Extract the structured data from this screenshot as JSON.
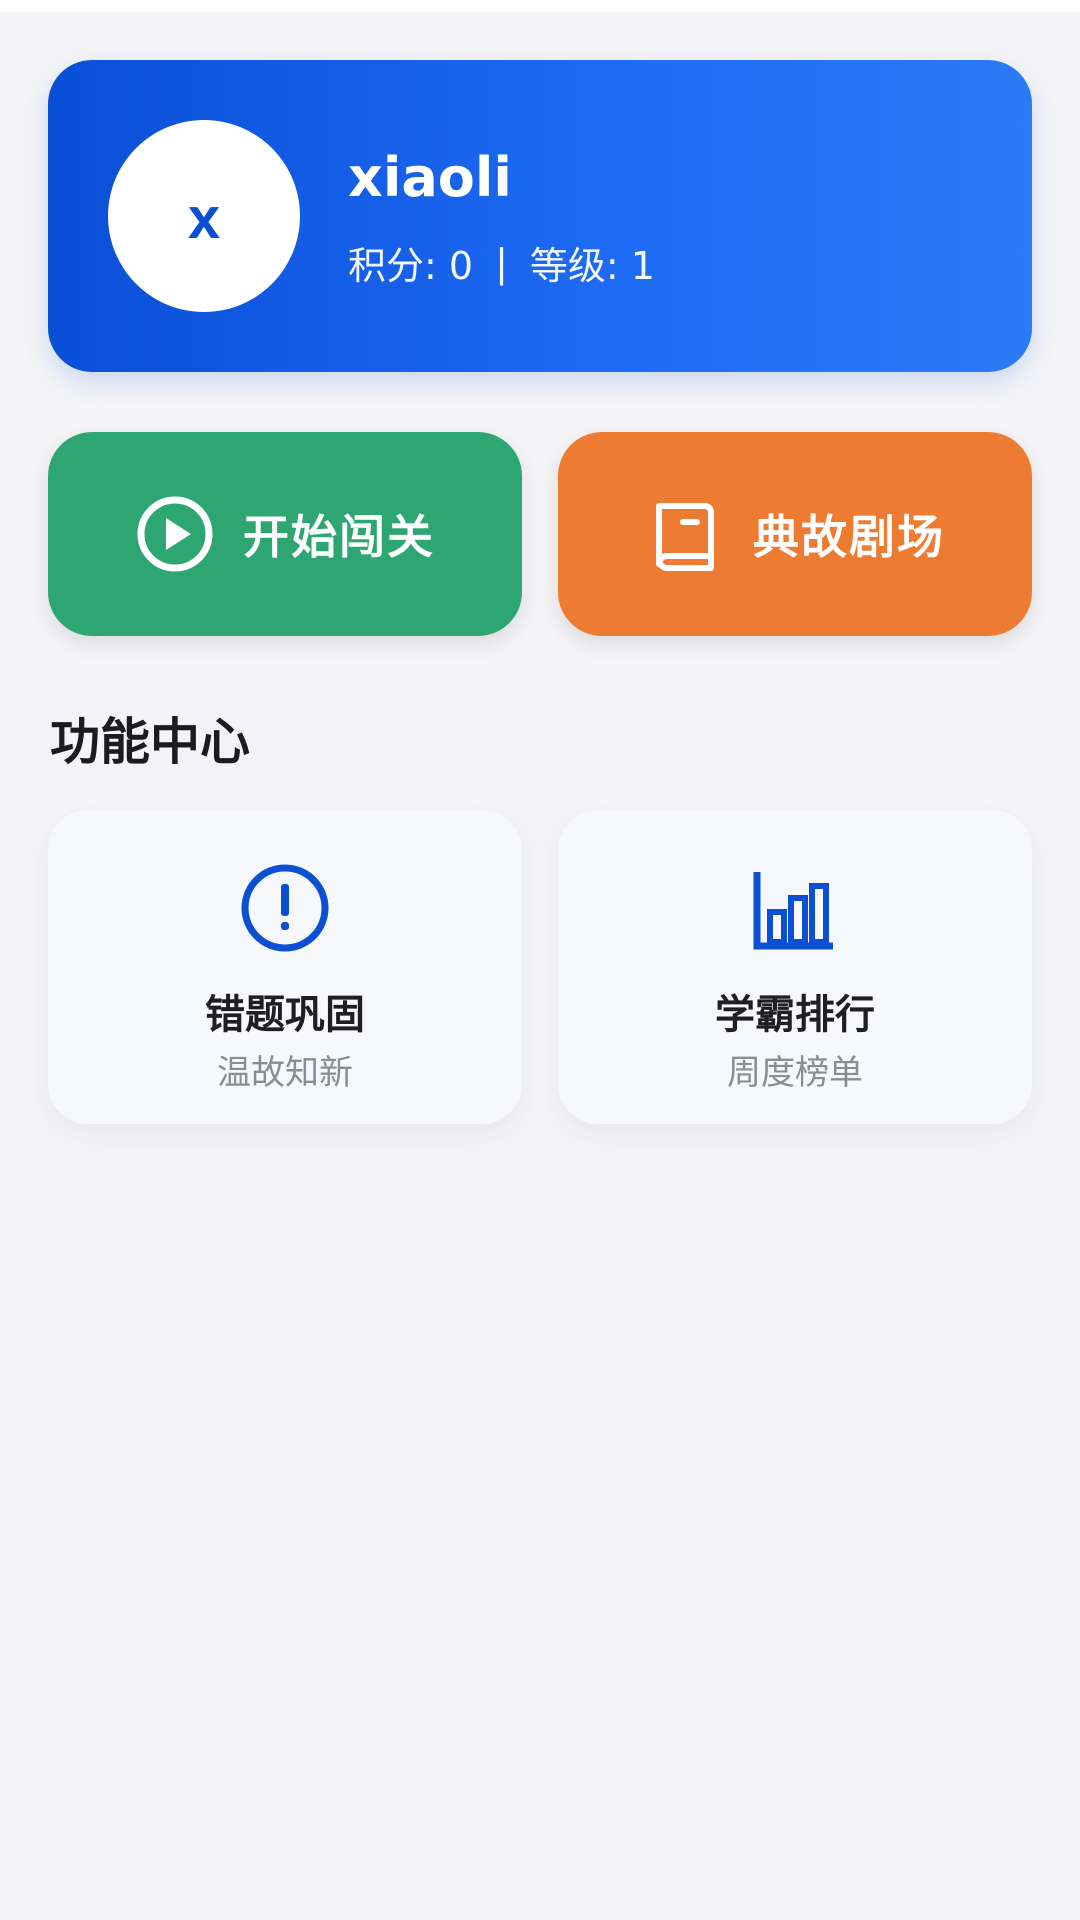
{
  "profile": {
    "avatar_letter": "x",
    "username": "xiaoli",
    "points_label": "积分: 0",
    "separator": "|",
    "level_label": "等级: 1"
  },
  "actions": [
    {
      "label": "开始闯关",
      "icon": "play-circle-icon",
      "color": "#2da672"
    },
    {
      "label": "典故剧场",
      "icon": "book-icon",
      "color": "#ed7c32"
    }
  ],
  "section": {
    "title": "功能中心"
  },
  "features": [
    {
      "title": "错题巩固",
      "subtitle": "温故知新",
      "icon": "alert-circle-icon"
    },
    {
      "title": "学霸排行",
      "subtitle": "周度榜单",
      "icon": "bar-chart-icon"
    }
  ],
  "colors": {
    "brand_blue": "#1f6cf4",
    "green": "#2da672",
    "orange": "#ed7c32",
    "background": "#f4f4f6"
  }
}
